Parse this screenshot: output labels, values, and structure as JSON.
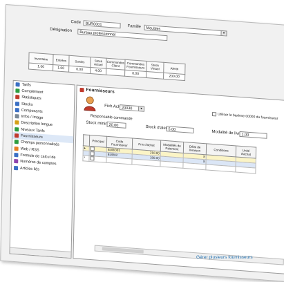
{
  "header": {
    "code_label": "Code",
    "code_value": "BUR0001",
    "famille_label": "Famille",
    "famille_value": "Meubles",
    "designation_label": "Désignation",
    "designation_value": "Bureau professionnel"
  },
  "stock": {
    "headers": [
      "Inventaire",
      "Entrées",
      "Sorties",
      "Stock Actuel",
      "Commandes Client",
      "Commandes Fournisseurs",
      "Stock Virtuel",
      "Alerte"
    ],
    "values": [
      "1.00",
      "1.00",
      "0.00",
      "4.00",
      "",
      "0.00",
      "",
      "200.00"
    ]
  },
  "sidebar": {
    "items": [
      {
        "label": "Tarifs",
        "color": "#3a6fc4"
      },
      {
        "label": "Complément",
        "color": "#2e9d3f"
      },
      {
        "label": "Statistiques",
        "color": "#c0392b"
      },
      {
        "label": "Stocks",
        "color": "#3a6fc4"
      },
      {
        "label": "Composants",
        "color": "#3a6fc4"
      },
      {
        "label": "Infos / Image",
        "color": "#7a8896"
      },
      {
        "label": "Description longue",
        "color": "#d4a017"
      },
      {
        "label": "Niveaux Tarifs",
        "color": "#2e9d3f"
      },
      {
        "label": "Fournisseurs",
        "color": "#c0392b"
      },
      {
        "label": "Champs personnalisés",
        "color": "#2e9d3f"
      },
      {
        "label": "Web / RSS",
        "color": "#e67e22"
      },
      {
        "label": "Formule de calcul de",
        "color": "#3a6fc4"
      },
      {
        "label": "Numéros de comptes",
        "color": "#8e44ad"
      },
      {
        "label": "Articles liés",
        "color": "#3a6fc4"
      }
    ],
    "selected_index": 8
  },
  "fournisseurs": {
    "title": "Fournisseurs",
    "fiche_achat_label": "Fich Achat",
    "fiche_achat_value": "20030",
    "checkbox_label": "Utiliser le barème 00000 du fournisseur",
    "responsable_label": "Responsable commande",
    "stock_minimum_label": "Stock minimum",
    "stock_minimum_value": "20.00",
    "stock_alerte_label": "Stock d'alerte",
    "stock_alerte_value": "5.00",
    "delai_label": "Modalité de livraison",
    "delai_value": "1.00",
    "grid_headers": [
      "",
      "Principal",
      "Code Fournisseur",
      "Prix d'achat",
      "Modalités de Paiement",
      "Délai de livraison",
      "Conditions",
      "Unité d'achat"
    ],
    "grid_rows": [
      {
        "principal": "",
        "code": "BURO01",
        "prix": "210.00",
        "modalite": "",
        "delai": "8",
        "conditions": "",
        "unite": ""
      },
      {
        "principal": "",
        "code": "BUR02",
        "prix": "180.00",
        "modalite": "",
        "delai": "8",
        "conditions": "",
        "unite": ""
      },
      {
        "principal": "",
        "code": "",
        "prix": "",
        "modalite": "",
        "delai": "",
        "conditions": "",
        "unite": ""
      }
    ]
  },
  "caption": "Gérer plusieurs fournisseurs"
}
